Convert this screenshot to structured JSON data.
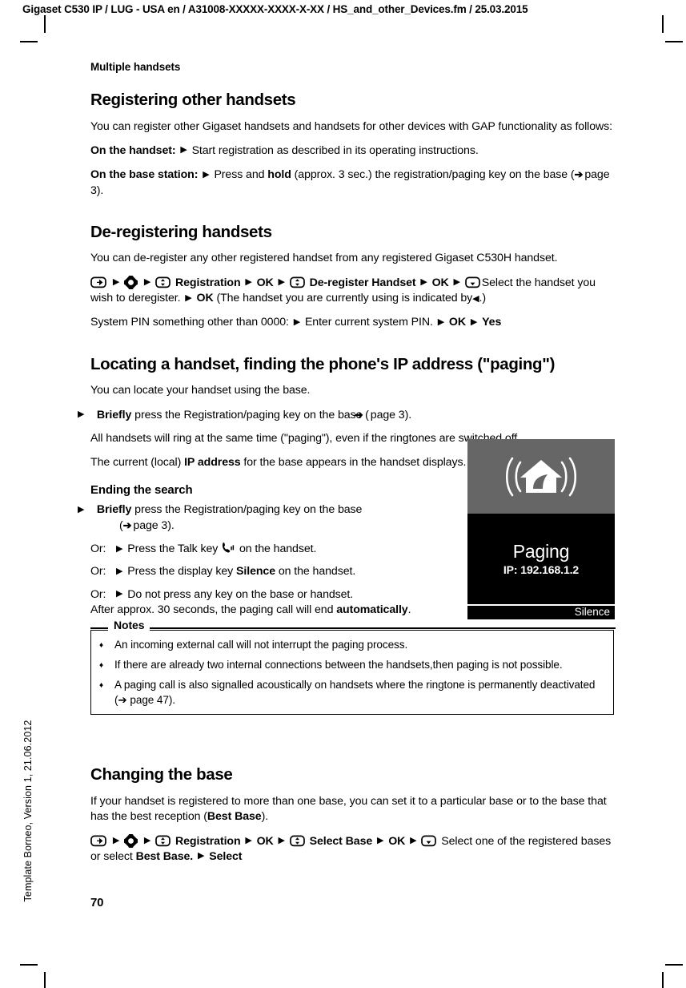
{
  "header": {
    "running_head": "Gigaset C530 IP / LUG - USA en / A31008-XXXXX-XXXX-X-XX / HS_and_other_Devices.fm / 25.03.2015"
  },
  "side_note": "Template Borneo, Version 1, 21.06.2012",
  "chapter": "Multiple handsets",
  "page_number": "70",
  "sections": {
    "registering": {
      "title": "Registering other handsets",
      "intro": "You can register other Gigaset handsets and handsets for other devices with GAP functionality as follows:",
      "handset_label": "On the handset:",
      "handset_step": "Start registration as described in its operating instructions.",
      "base_label": "On the base station:",
      "base_step_pre": "Press and",
      "base_step_bold": "hold",
      "base_step_post": "(approx. 3 sec.) the registration/paging key on the base (",
      "base_step_ref": "page 3",
      "base_step_end": ")."
    },
    "deregistering": {
      "title": "De-registering handsets",
      "intro": "You can de-register any other registered handset from any registered Gigaset C530H handset.",
      "path": {
        "registration": "Registration",
        "ok1": "OK",
        "deregister_handset": "De-register Handset",
        "ok2": "OK",
        "select_handset": "Select the handset you wish to deregister.",
        "ok3": "OK",
        "note": "(The handset you are currently using is indicated by",
        "note_end": ".)"
      },
      "pin_line": {
        "label": "System PIN something other than 0000:",
        "step1": "Enter current system PIN.",
        "ok": "OK",
        "yes": "Yes"
      }
    },
    "locating": {
      "title": "Locating a handset, finding the phone's IP address (\"paging\")",
      "intro": "You can locate your handset using the base.",
      "step_bold": "Briefly",
      "step_text": "press the Registration/paging key on the base (",
      "step_ref": "page 3",
      "step_end": ").",
      "all_ring": "All handsets will ring at the same time (\"paging\"), even if the ringtones are switched off.",
      "ip_pre": "The current (local)",
      "ip_bold": "IP address",
      "ip_post": "for the base appears in the handset displays."
    },
    "ending": {
      "title": "Ending the search",
      "step1_bold": "Briefly",
      "step1_text": "press the Registration/paging key on the base",
      "step1_ref": "page 3",
      "step1_end": ").",
      "or_label": "Or:",
      "or1_pre": "Press the Talk key",
      "or1_post": "on the handset.",
      "or2_pre": "Press the display key",
      "or2_bold": "Silence",
      "or2_post": "on the handset.",
      "or3": "Do not press any key on the base or handset.",
      "after_pre": "After approx. 30 seconds, the paging call will end",
      "after_bold": "automatically",
      "after_end": "."
    },
    "changing": {
      "title": "Changing the base",
      "intro_pre": "If your handset is registered to more than one base, you can set it to a particular base or to the base that has the best reception (",
      "intro_bold": "Best Base",
      "intro_post": ").",
      "path": {
        "registration": "Registration",
        "ok1": "OK",
        "select_base": "Select Base",
        "ok2": "OK",
        "select_one": "Select one of the registered bases or select",
        "best_base": "Best Base.",
        "select": "Select"
      }
    }
  },
  "notes_box": {
    "legend": "Notes",
    "items": [
      "An incoming external call will not interrupt the paging process.",
      "If there are already two internal connections between the handsets,then paging is not possible.",
      "A paging call is also signalled acoustically on handsets where the ringtone is permanently deactivated (➔ page 47)."
    ]
  },
  "handset_display": {
    "icon": "base-paging-icon",
    "title": "Paging",
    "ip": "IP: 192.168.1.2",
    "softkey": "Silence",
    "colors": {
      "top_bg": "#666666",
      "body_bg": "#000000",
      "text": "#ffffff"
    }
  },
  "glyphs": {
    "step_triangle": "▶",
    "page_arrow": "➔",
    "left_triangle": "◀",
    "diamond": "♦"
  }
}
